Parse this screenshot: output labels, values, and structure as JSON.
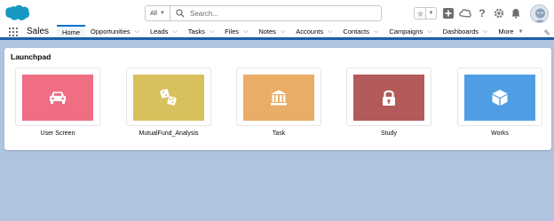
{
  "header": {
    "search_scope": "All",
    "search_placeholder": "Search...",
    "icons": [
      "salesforce-cloud-logo",
      "star-icon",
      "chevron-down-icon",
      "plus-icon",
      "help-cloud-icon",
      "question-icon",
      "gear-icon",
      "bell-icon",
      "avatar"
    ]
  },
  "nav": {
    "app_name": "Sales",
    "tabs": [
      {
        "label": "Home",
        "active": true,
        "dropdown": false
      },
      {
        "label": "Opportunities",
        "dropdown": true
      },
      {
        "label": "Leads",
        "dropdown": true
      },
      {
        "label": "Tasks",
        "dropdown": true
      },
      {
        "label": "Files",
        "dropdown": true
      },
      {
        "label": "Notes",
        "dropdown": true
      },
      {
        "label": "Accounts",
        "dropdown": true
      },
      {
        "label": "Contacts",
        "dropdown": true
      },
      {
        "label": "Campaigns",
        "dropdown": true
      },
      {
        "label": "Dashboards",
        "dropdown": true
      },
      {
        "label": "More",
        "dropdown": true
      }
    ]
  },
  "launchpad": {
    "title": "Launchpad",
    "tiles": [
      {
        "label": "User Screen",
        "icon": "car-icon",
        "color": "#ef6e84"
      },
      {
        "label": "MutualFund_Analysis",
        "icon": "dice-icon",
        "color": "#d8c05c"
      },
      {
        "label": "Task",
        "icon": "bank-icon",
        "color": "#e9ad67"
      },
      {
        "label": "Study",
        "icon": "lock-icon",
        "color": "#b35a5a"
      },
      {
        "label": "Works",
        "icon": "cube-icon",
        "color": "#4f9ee3"
      }
    ]
  },
  "colors": {
    "nav_accent": "#1b5fa8",
    "page_background": "#b0c4df"
  }
}
